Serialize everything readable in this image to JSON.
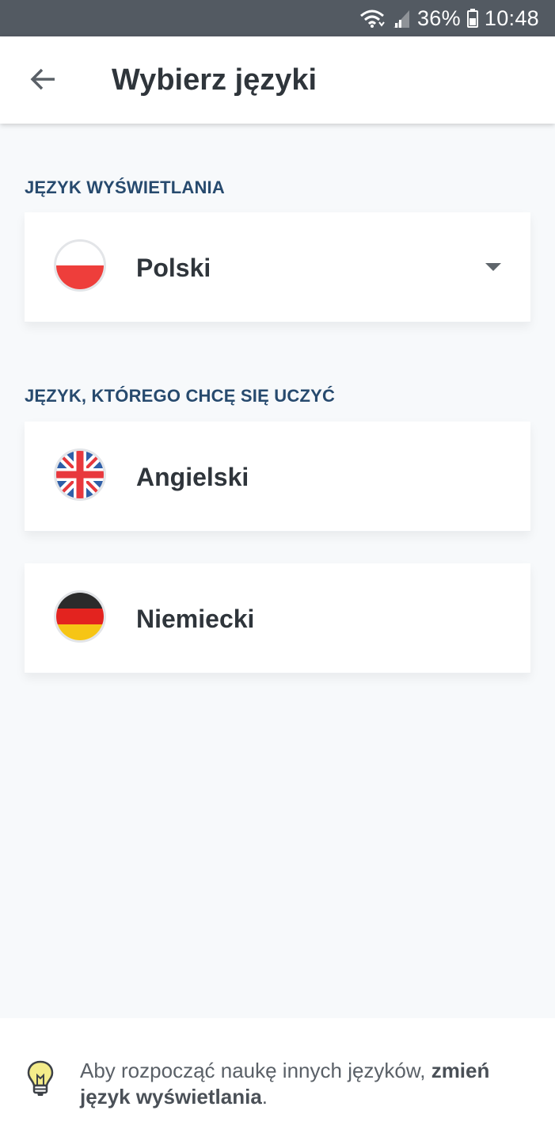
{
  "status_bar": {
    "battery_percent": "36%",
    "time": "10:48",
    "icons": [
      "wifi-icon",
      "signal-icon",
      "battery-icon"
    ]
  },
  "app_bar": {
    "back_icon": "arrow-left-icon",
    "title": "Wybierz języki"
  },
  "display_language": {
    "section_label": "JĘZYK WYŚWIETLANIA",
    "selected": {
      "label": "Polski",
      "flag": "poland-flag-icon"
    },
    "dropdown_icon": "caret-down-icon"
  },
  "learn_language": {
    "section_label": "JĘZYK, KTÓREGO CHCĘ SIĘ UCZYĆ",
    "items": [
      {
        "label": "Angielski",
        "flag": "uk-flag-icon"
      },
      {
        "label": "Niemiecki",
        "flag": "germany-flag-icon"
      }
    ]
  },
  "footer": {
    "icon": "lightbulb-icon",
    "text_prefix": "Aby rozpocząć naukę innych języków, ",
    "text_link": "zmień język wyświetlania",
    "text_suffix": "."
  },
  "colors": {
    "status_bar": "#535a62",
    "section_label": "#274a6e",
    "background": "#f7f9fb"
  }
}
